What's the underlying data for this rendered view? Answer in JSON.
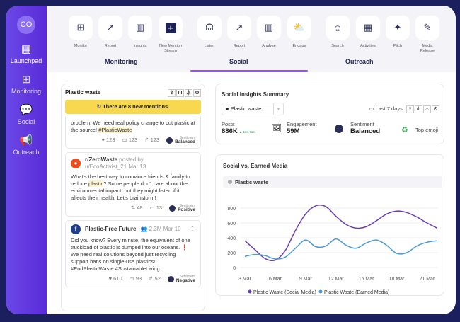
{
  "sidebar": {
    "avatar": "CO",
    "items": [
      {
        "label": "Launchpad",
        "icon": "grid-icon"
      },
      {
        "label": "Monitoring",
        "icon": "monitor-icon"
      },
      {
        "label": "Social",
        "icon": "chat-icon"
      },
      {
        "label": "Outreach",
        "icon": "megaphone-icon"
      }
    ]
  },
  "toolbar": {
    "tools": [
      {
        "label": "Monitor",
        "icon": "monitor-icon",
        "glyph": "⊞"
      },
      {
        "label": "Report",
        "icon": "report-icon",
        "glyph": "↗"
      },
      {
        "label": "Insights",
        "icon": "insights-icon",
        "glyph": "▥"
      },
      {
        "label": "New Mention Stream",
        "icon": "plus-icon",
        "glyph": "+"
      },
      {
        "label": "Listen",
        "icon": "listen-icon",
        "glyph": "☊"
      },
      {
        "label": "Report",
        "icon": "report-icon",
        "glyph": "↗"
      },
      {
        "label": "Analyse",
        "icon": "analyse-icon",
        "glyph": "▥"
      },
      {
        "label": "Engage",
        "icon": "engage-icon",
        "glyph": "⛅"
      },
      {
        "label": "Search",
        "icon": "search-contacts-icon",
        "glyph": "☺"
      },
      {
        "label": "Activities",
        "icon": "activities-icon",
        "glyph": "▦"
      },
      {
        "label": "Pitch",
        "icon": "sparkle-icon",
        "glyph": "✦"
      },
      {
        "label": "Media Release",
        "icon": "edit-doc-icon",
        "glyph": "✎"
      }
    ],
    "groups": [
      "Monitoring",
      "Social",
      "Outreach"
    ],
    "active_group": "Social"
  },
  "feed": {
    "title": "Plastic waste",
    "banner": "There are 8 new mentions.",
    "post0": {
      "text_pre": "problem. We need real policy change to cut plastic at the source! ",
      "hashtag": "#PlasticWaste",
      "likes": "123",
      "comments": "123",
      "shares": "123",
      "sentiment_label": "Sentiment",
      "sentiment": "Balanced"
    },
    "post1": {
      "source": "r/ZeroWaste",
      "posted_by": "posted by",
      "user": "u/EcoActivist_21",
      "date": "Mar 13",
      "text_a": "What's the best way to convince friends & family to reduce ",
      "text_hl": "plastic",
      "text_b": "? Some people don't care about the environmental impact, but they might listen if it affects their health. Let's brainstorm!",
      "votes": "48",
      "comments": "13",
      "sentiment_label": "Sentiment",
      "sentiment": "Positive"
    },
    "post2": {
      "source": "Plastic-Free Future",
      "followers": "2.3M",
      "date": "Mar 10",
      "text": "Did you know? Every minute, the equivalent of one truckload of plastic is dumped into our oceans. ❗ We need real solutions beyond just recycling—support bans on single-use plastics! #EndPlasticWaste #SustainableLiving",
      "likes": "610",
      "comments": "93",
      "shares": "52",
      "sentiment_label": "Sentiment",
      "sentiment": "Negative"
    }
  },
  "summary": {
    "title": "Social Insights Summary",
    "select": "Plastic waste",
    "range": "Last 7 days",
    "posts_label": "Posts",
    "posts": "886K",
    "posts_change": "134.71%",
    "eng_label": "Engagement",
    "eng": "59M",
    "sent_label": "Sentiment",
    "sent": "Balanced",
    "emoji_label": "Top emoji",
    "emoji": "♻"
  },
  "chart_data": {
    "type": "line",
    "title": "Social vs. Earned Media",
    "filter": "Plastic waste",
    "x": [
      "3 Mar",
      "4 Mar",
      "5 Mar",
      "6 Mar",
      "7 Mar",
      "8 Mar",
      "9 Mar",
      "10 Mar",
      "11 Mar",
      "12 Mar",
      "13 Mar",
      "14 Mar",
      "15 Mar",
      "16 Mar",
      "17 Mar",
      "18 Mar",
      "19 Mar",
      "20 Mar",
      "21 Mar",
      "22 Mar"
    ],
    "xticks": [
      "3 Mar",
      "6 Mar",
      "9 Mar",
      "12 Mar",
      "15 Mar",
      "18 Mar",
      "21 Mar"
    ],
    "yticks": [
      0,
      200,
      400,
      600,
      800
    ],
    "ylim": [
      0,
      800
    ],
    "series": [
      {
        "name": "Plastic Waste (Social Media)",
        "color": "#6a3db8",
        "values": [
          360,
          240,
          120,
          100,
          230,
          500,
          720,
          830,
          820,
          690,
          580,
          530,
          550,
          630,
          720,
          760,
          740,
          680,
          600,
          530
        ]
      },
      {
        "name": "Plastic Waste (Earned Media)",
        "color": "#4a9ad8",
        "values": [
          150,
          175,
          160,
          115,
          140,
          260,
          370,
          280,
          290,
          385,
          300,
          260,
          330,
          370,
          300,
          190,
          200,
          290,
          340,
          360
        ]
      }
    ]
  }
}
